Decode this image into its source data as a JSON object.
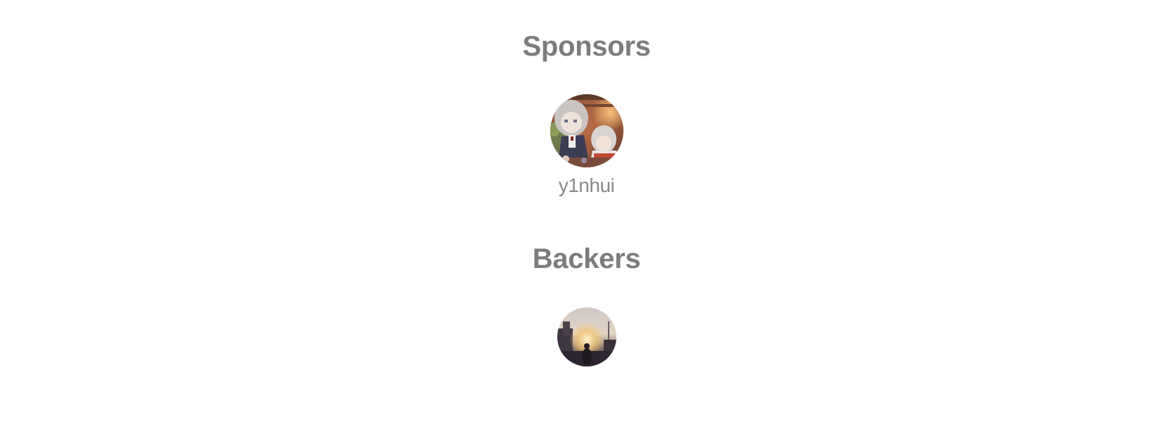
{
  "sponsors": {
    "title": "Sponsors",
    "items": [
      {
        "name": "y1nhui",
        "avatar_icon": "anime-avatar-icon"
      }
    ]
  },
  "backers": {
    "title": "Backers",
    "items": [
      {
        "avatar_icon": "sunset-avatar-icon"
      }
    ]
  },
  "colors": {
    "heading": "#7c7c7c",
    "name_text": "#8a8a8a",
    "background": "#ffffff"
  }
}
